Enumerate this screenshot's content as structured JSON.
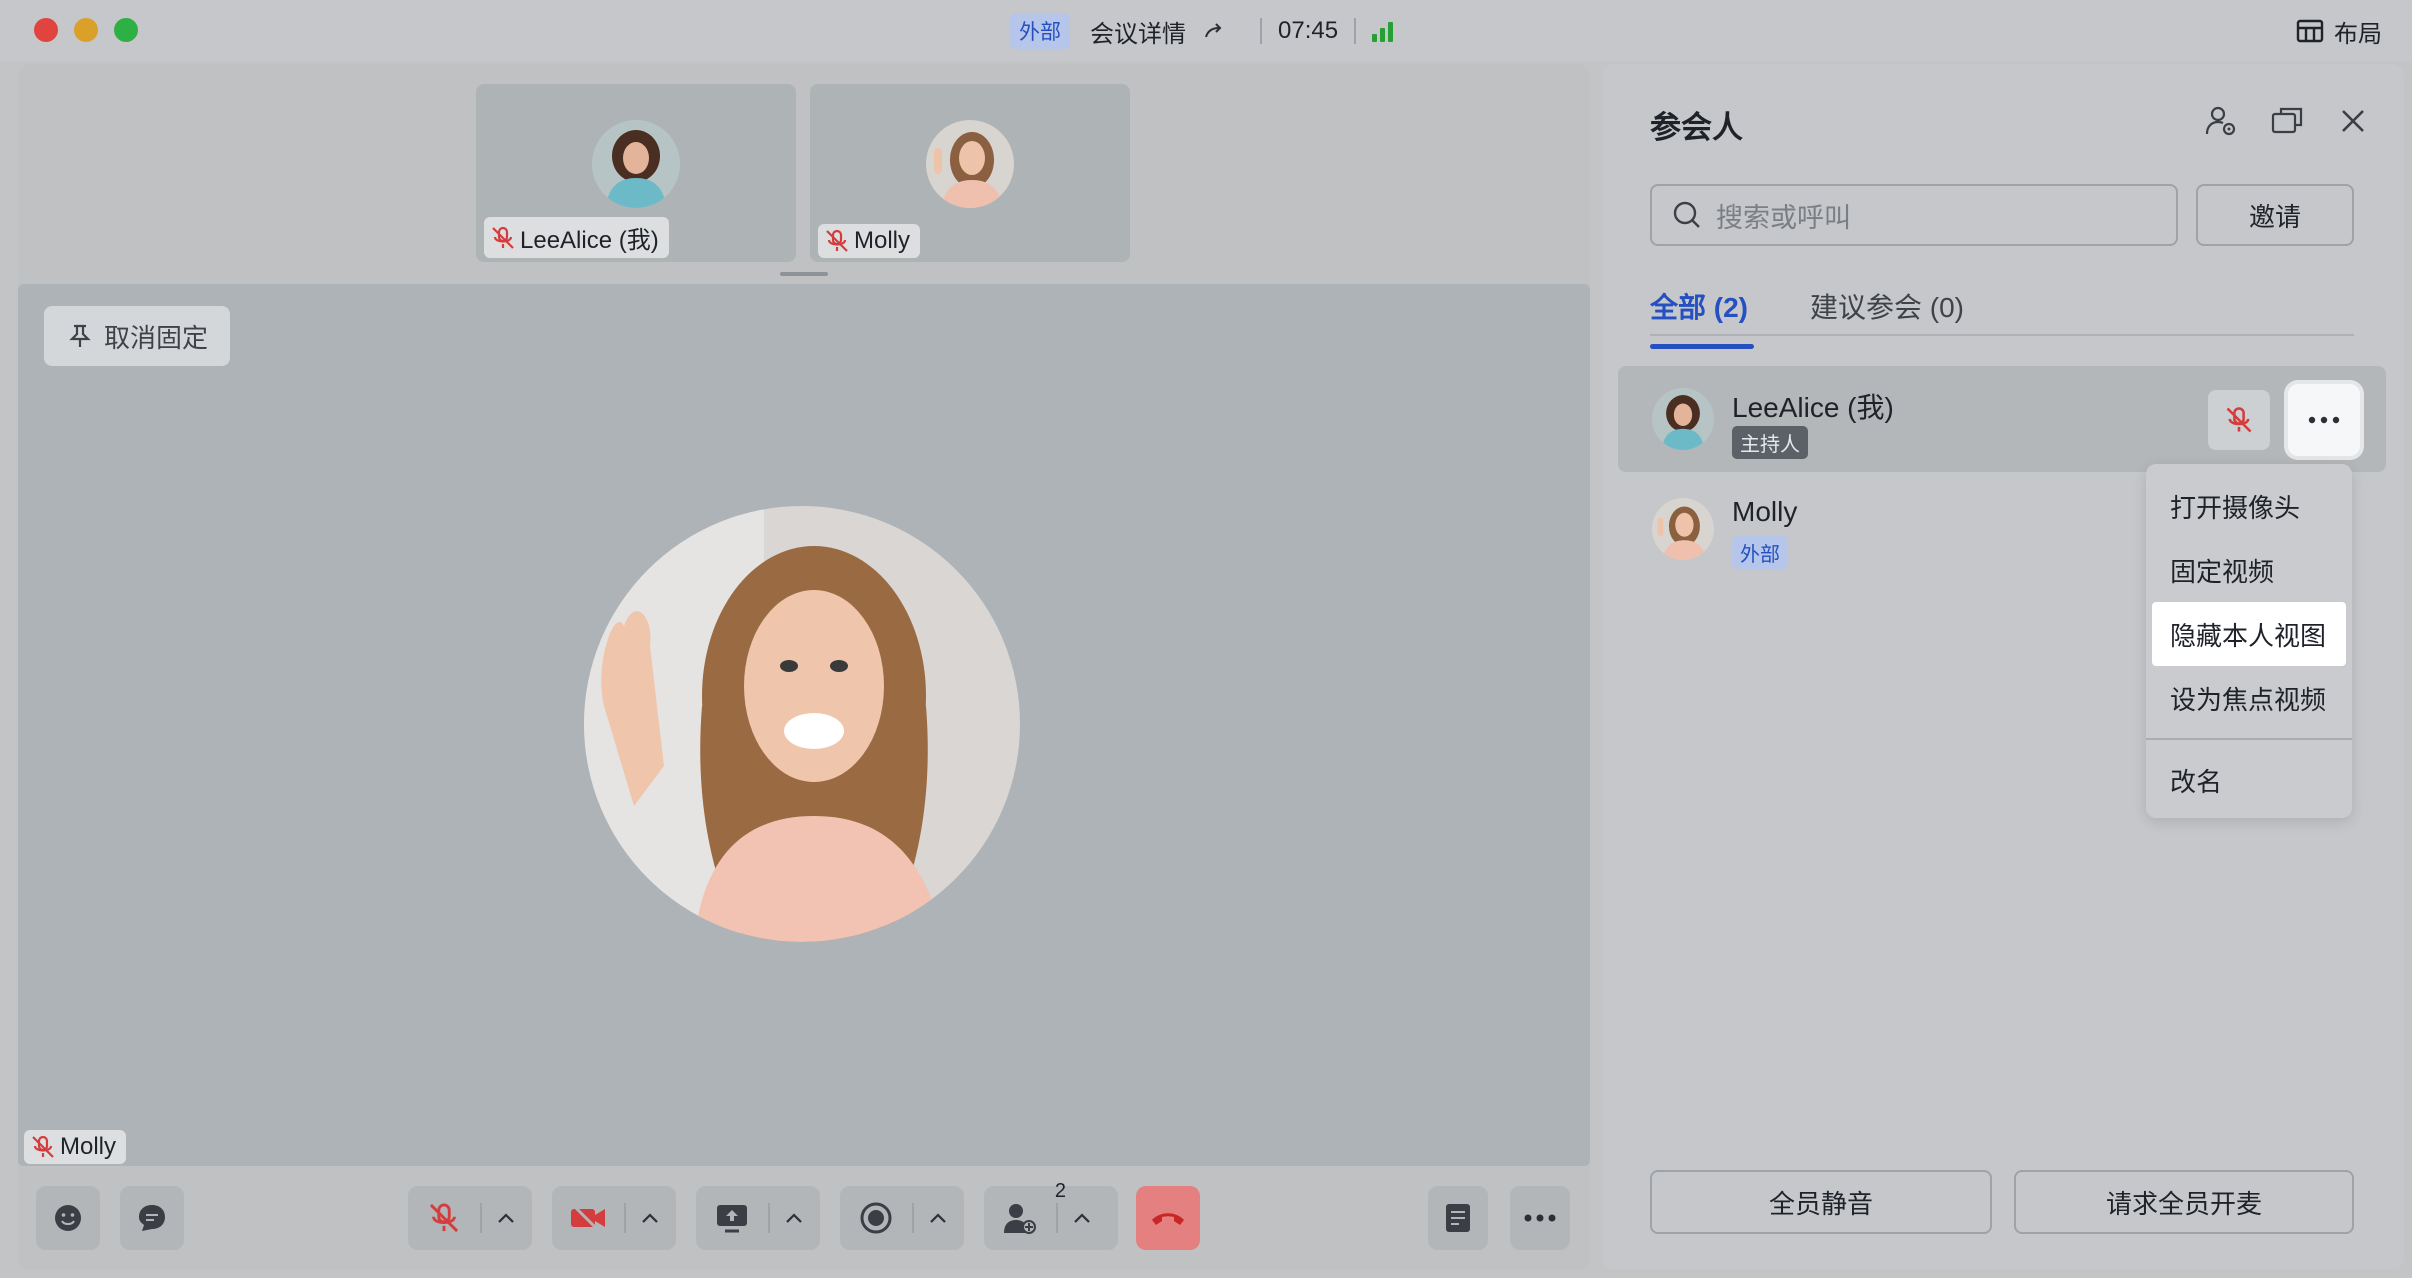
{
  "titlebar": {
    "external_badge": "外部",
    "title": "会议详情",
    "time": "07:45",
    "layout_label": "布局"
  },
  "stage": {
    "thumbnails": [
      {
        "name": "LeeAlice (我)"
      },
      {
        "name": "Molly"
      }
    ],
    "unpin_label": "取消固定",
    "main_name": "Molly"
  },
  "toolbar": {
    "participant_count": "2"
  },
  "panel": {
    "title": "参会人",
    "search_placeholder": "搜索或呼叫",
    "invite_label": "邀请",
    "tabs": [
      {
        "label": "全部 (2)",
        "active": true
      },
      {
        "label": "建议参会 (0)",
        "active": false
      }
    ],
    "participants": [
      {
        "name": "LeeAlice (我)",
        "badge": "主持人"
      },
      {
        "name": "Molly",
        "badge": "外部"
      }
    ],
    "menu": {
      "items": [
        "打开摄像头",
        "固定视频",
        "隐藏本人视图",
        "设为焦点视频",
        "改名"
      ],
      "highlighted": "隐藏本人视图"
    },
    "mute_all_label": "全员静音",
    "request_unmute_label": "请求全员开麦"
  },
  "colors": {
    "accent": "#2450c2",
    "mute_red": "#d43d3d",
    "hangup": "#e48080",
    "signal_green": "#25a035"
  }
}
